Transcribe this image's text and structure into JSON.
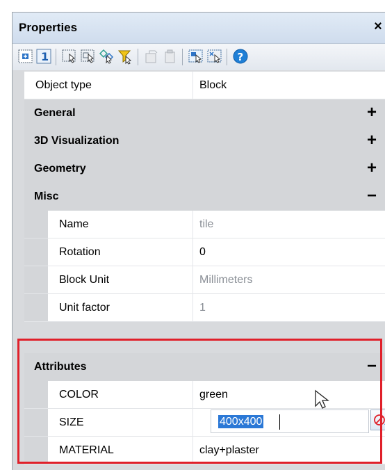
{
  "window": {
    "title": "Properties",
    "close_glyph": "×"
  },
  "toolbar": {
    "buttons": [
      "toggle-pickadd-icon",
      "quick-select-1-icon",
      "select-objects-icon",
      "select-similar-icon",
      "select-all-icon",
      "filter-icon",
      "copy-properties-icon",
      "paste-properties-icon",
      "select-block-icon",
      "deselect-block-icon",
      "help-icon"
    ]
  },
  "object_type": {
    "label": "Object type",
    "value": "Block"
  },
  "sections": {
    "general": {
      "label": "General",
      "toggle": "+"
    },
    "visualization": {
      "label": "3D Visualization",
      "toggle": "+"
    },
    "geometry": {
      "label": "Geometry",
      "toggle": "+"
    },
    "misc": {
      "label": "Misc",
      "toggle": "−"
    },
    "attributes": {
      "label": "Attributes",
      "toggle": "−"
    }
  },
  "misc_props": [
    {
      "key": "Name",
      "value": "tile"
    },
    {
      "key": "Rotation",
      "value": "0"
    },
    {
      "key": "Block Unit",
      "value": "Millimeters"
    },
    {
      "key": "Unit factor",
      "value": "1"
    }
  ],
  "attribute_props": [
    {
      "key": "COLOR",
      "value": "green"
    },
    {
      "key": "SIZE",
      "value": "400x400"
    },
    {
      "key": "MATERIAL",
      "value": "clay+plaster"
    }
  ],
  "colors": {
    "highlight": "#e0202a",
    "selection": "#2b78d6",
    "help": "#1f7fd6"
  }
}
